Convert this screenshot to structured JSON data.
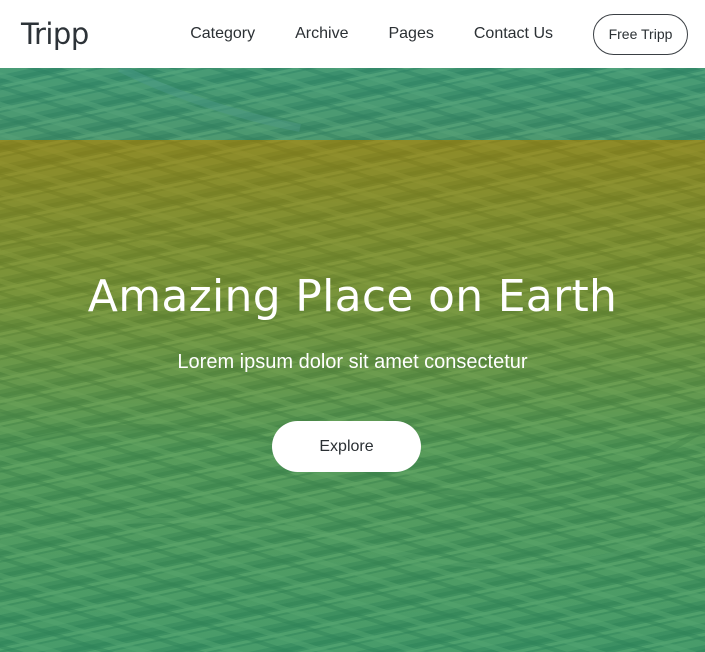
{
  "header": {
    "logo": "Tripp",
    "nav": [
      {
        "label": "Category"
      },
      {
        "label": "Archive"
      },
      {
        "label": "Pages"
      },
      {
        "label": "Contact Us"
      }
    ],
    "cta_label": "Free Tripp"
  },
  "hero": {
    "title": "Amazing Place on Earth",
    "subtitle": "Lorem ipsum dolor sit amet consectetur",
    "button_label": "Explore",
    "background": "terraced-fields-photo",
    "colors": {
      "tint_top": "#1e968c",
      "tint_gold": "#968214",
      "tint_green": "#1e9678"
    }
  }
}
